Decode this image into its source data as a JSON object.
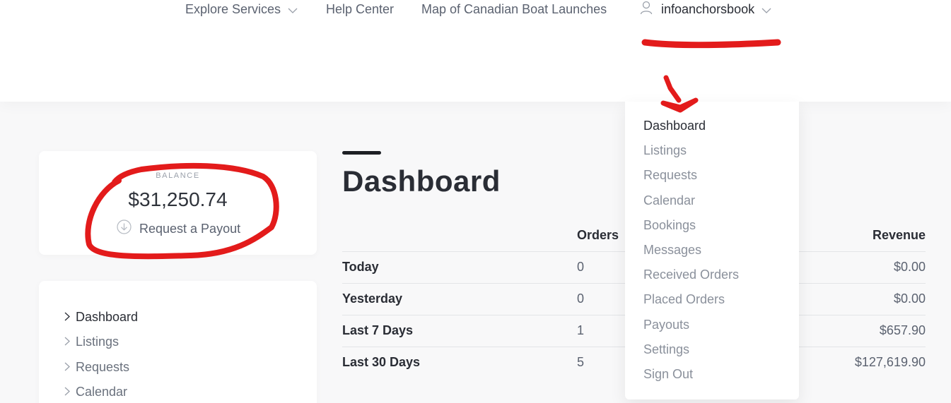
{
  "header": {
    "nav": [
      {
        "label": "Explore Services",
        "has_chevron": true
      },
      {
        "label": "Help Center"
      },
      {
        "label": "Map of Canadian Boat Launches"
      }
    ],
    "user": {
      "username": "infoanchorsbook",
      "icon": "user-icon",
      "has_chevron": true
    }
  },
  "balance": {
    "label": "BALANCE",
    "amount": "$31,250.74",
    "payout_label": "Request a Payout",
    "payout_icon": "download-circle-icon"
  },
  "sidebar": {
    "items": [
      {
        "label": "Dashboard",
        "active": true
      },
      {
        "label": "Listings"
      },
      {
        "label": "Requests"
      },
      {
        "label": "Calendar"
      }
    ]
  },
  "main": {
    "title": "Dashboard",
    "table": {
      "columns": [
        "",
        "Orders",
        "Revenue"
      ],
      "rows": [
        {
          "period": "Today",
          "orders": "0",
          "revenue": "$0.00"
        },
        {
          "period": "Yesterday",
          "orders": "0",
          "revenue": "$0.00"
        },
        {
          "period": "Last 7 Days",
          "orders": "1",
          "revenue": "$657.90"
        },
        {
          "period": "Last 30 Days",
          "orders": "5",
          "revenue": "$127,619.90"
        }
      ]
    }
  },
  "user_menu": {
    "items": [
      {
        "label": "Dashboard",
        "active": true
      },
      {
        "label": "Listings"
      },
      {
        "label": "Requests"
      },
      {
        "label": "Calendar"
      },
      {
        "label": "Bookings"
      },
      {
        "label": "Messages"
      },
      {
        "label": "Received Orders"
      },
      {
        "label": "Placed Orders"
      },
      {
        "label": "Payouts"
      },
      {
        "label": "Settings"
      },
      {
        "label": "Sign Out"
      }
    ]
  },
  "colors": {
    "annotation": "#e31b1b",
    "text_dark": "#2a2d35",
    "text_muted": "#8a909b"
  }
}
